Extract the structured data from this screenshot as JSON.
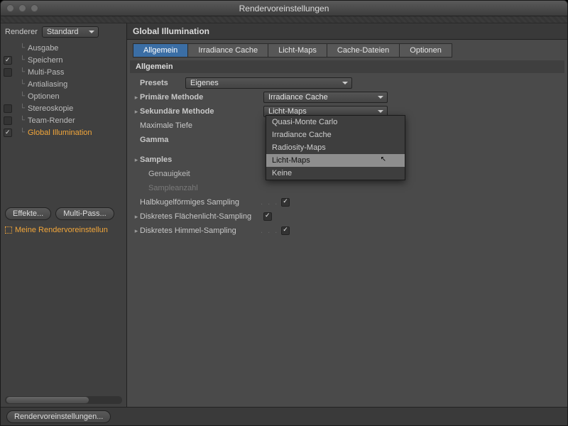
{
  "window": {
    "title": "Rendervoreinstellungen"
  },
  "renderer": {
    "label": "Renderer",
    "value": "Standard"
  },
  "sidebar": {
    "items": [
      {
        "label": "Ausgabe",
        "checked": null
      },
      {
        "label": "Speichern",
        "checked": true
      },
      {
        "label": "Multi-Pass",
        "checked": false
      },
      {
        "label": "Antialiasing",
        "checked": null
      },
      {
        "label": "Optionen",
        "checked": null
      },
      {
        "label": "Stereoskopie",
        "checked": false
      },
      {
        "label": "Team-Render",
        "checked": false
      },
      {
        "label": "Global Illumination",
        "checked": true,
        "active": true
      }
    ],
    "buttons": {
      "effects": "Effekte...",
      "multipass": "Multi-Pass..."
    },
    "preset": "Meine Rendervoreinstellun"
  },
  "panel": {
    "title": "Global Illumination",
    "tabs": [
      "Allgemein",
      "Irradiance Cache",
      "Licht-Maps",
      "Cache-Dateien",
      "Optionen"
    ],
    "activeTab": 0,
    "section": "Allgemein",
    "presets": {
      "label": "Presets",
      "value": "Eigenes"
    },
    "primary": {
      "label": "Primäre Methode",
      "value": "Irradiance Cache"
    },
    "secondary": {
      "label": "Sekundäre Methode",
      "value": "Licht-Maps",
      "options": [
        "Quasi-Monte Carlo",
        "Irradiance Cache",
        "Radiosity-Maps",
        "Licht-Maps",
        "Keine"
      ],
      "highlighted": 3
    },
    "maxDepth": {
      "label": "Maximale Tiefe"
    },
    "gamma": {
      "label": "Gamma"
    },
    "samples": {
      "label": "Samples"
    },
    "accuracy": {
      "label": "Genauigkeit"
    },
    "sampleCount": {
      "label": "Sampleanzahl"
    },
    "hemi": {
      "label": "Halbkugelförmiges Sampling",
      "checked": true
    },
    "area": {
      "label": "Diskretes Flächenlicht-Sampling",
      "checked": true
    },
    "sky": {
      "label": "Diskretes Himmel-Sampling",
      "checked": true
    }
  },
  "footer": {
    "button": "Rendervoreinstellungen..."
  }
}
